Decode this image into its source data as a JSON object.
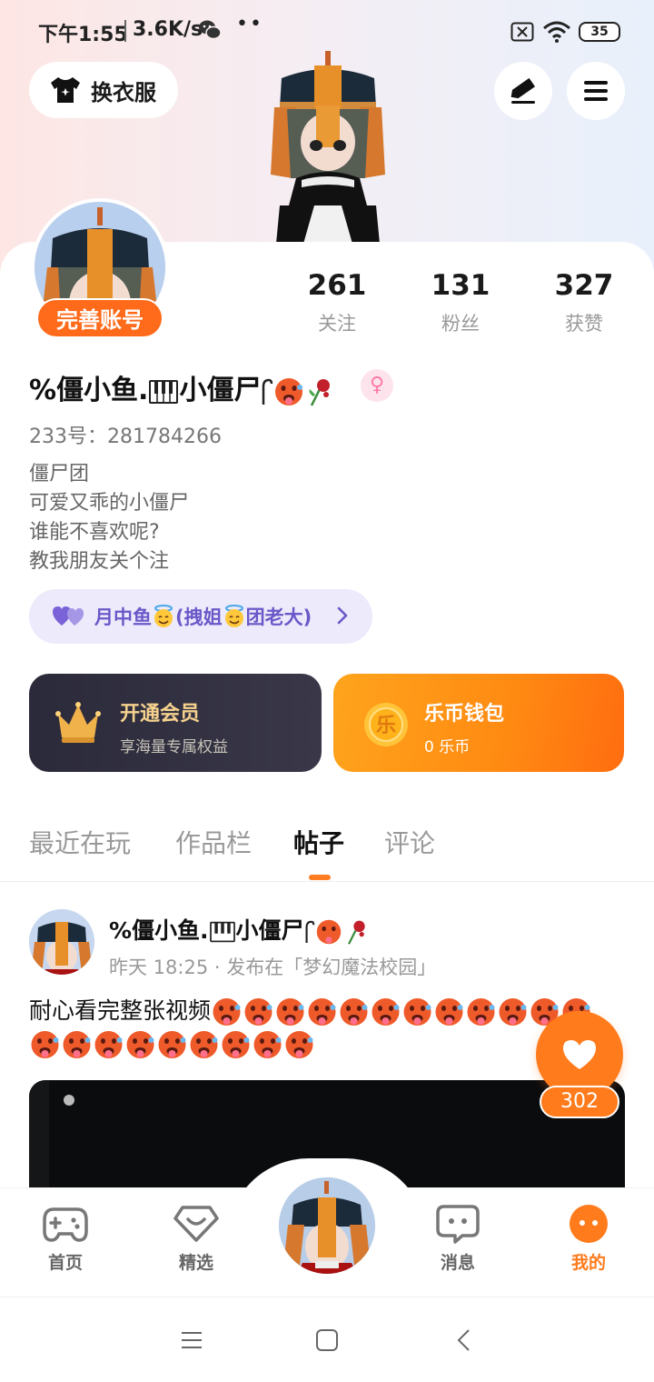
{
  "status_bar": {
    "time": "下午1:55",
    "speed": "3.6K/s",
    "dots": "••",
    "battery": "35"
  },
  "header": {
    "wardrobe_label": "换衣服"
  },
  "profile": {
    "complete_badge": "完善账号",
    "stats": [
      {
        "value": "261",
        "label": "关注"
      },
      {
        "value": "131",
        "label": "粉丝"
      },
      {
        "value": "327",
        "label": "获赞"
      }
    ],
    "username_prefix": "%僵小鱼.",
    "username_suffix": "小僵尸",
    "gender_symbol": "♀",
    "uid": "233号：281784266",
    "bio_lines": [
      "僵尸团",
      "可爱又乖的小僵尸",
      "谁能不喜欢呢?",
      "教我朋友关个注"
    ],
    "group": {
      "part1": "月中鱼",
      "part2": "(拽姐",
      "part3": "团老大)"
    }
  },
  "cards": {
    "vip": {
      "title": "开通会员",
      "subtitle": "享海量专属权益"
    },
    "wallet": {
      "title": "乐币钱包",
      "subtitle": "0 乐币",
      "coin_char": "乐"
    }
  },
  "tabs": [
    {
      "label": "最近在玩",
      "active": false
    },
    {
      "label": "作品栏",
      "active": false
    },
    {
      "label": "帖子",
      "active": true
    },
    {
      "label": "评论",
      "active": false
    }
  ],
  "post": {
    "author_prefix": "%僵小鱼.",
    "author_suffix": "小僵尸",
    "meta": "昨天 18:25 · 发布在「梦幻魔法校园」",
    "text": "耐心看完整张视频",
    "like_count": "302"
  },
  "bottom_nav": [
    {
      "label": "首页",
      "icon": "gamepad-icon",
      "active": false
    },
    {
      "label": "精选",
      "icon": "heart-gem-icon",
      "active": false
    },
    {
      "label": "消息",
      "icon": "chat-icon",
      "active": false
    },
    {
      "label": "我的",
      "icon": "face-icon",
      "active": true
    }
  ],
  "colors": {
    "accent": "#ff7b1c",
    "vip_gold": "#f6d28e",
    "group_purple": "#6a58c8"
  }
}
